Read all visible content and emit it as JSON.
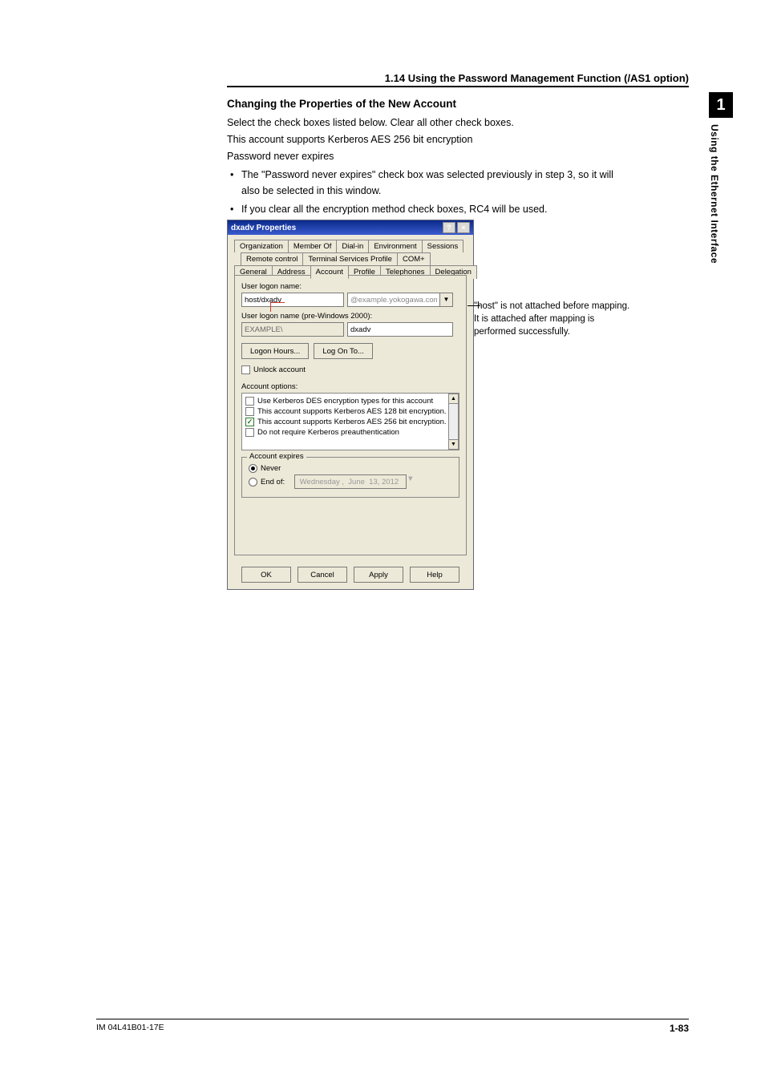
{
  "section": {
    "header": "1.14  Using the Password Management Function (/AS1 option)"
  },
  "chapter": {
    "number": "1",
    "side": "Using the Ethernet Interface"
  },
  "body": {
    "heading": "Changing the Properties of the New Account",
    "p1": "Select the check boxes listed below. Clear all other check boxes.",
    "p2": "This account supports Kerberos AES 256 bit encryption",
    "p3": "Password never expires",
    "li1": "The \"Password never expires\" check box was selected previously in step 3, so it will",
    "li1b": "also be selected in this window.",
    "li2": "If you clear all the encryption method check boxes, RC4 will be used."
  },
  "dialog": {
    "title": "dxadv Properties",
    "tabs_row1": [
      "Organization",
      "Member Of",
      "Dial-in",
      "Environment",
      "Sessions"
    ],
    "tabs_row2": [
      "Remote control",
      "Terminal Services Profile",
      "COM+"
    ],
    "tabs_row3": [
      "General",
      "Address",
      "Account",
      "Profile",
      "Telephones",
      "Delegation"
    ],
    "logon_label": "User logon name:",
    "logon_value": "host/dxadv",
    "domain_value": "@example.yokogawa.com",
    "pre2000_label": "User logon name (pre-Windows 2000):",
    "pre2000_domain": "EXAMPLE\\",
    "pre2000_user": "dxadv",
    "logon_hours_btn": "Logon Hours...",
    "log_on_to_btn": "Log On To...",
    "unlock_label": "Unlock account",
    "account_options_label": "Account options:",
    "opts": [
      {
        "text": "Use Kerberos DES encryption types for this account",
        "checked": false
      },
      {
        "text": "This account supports Kerberos AES 128 bit encryption.",
        "checked": false
      },
      {
        "text": "This account supports Kerberos AES 256 bit encryption.",
        "checked": true
      },
      {
        "text": "Do not require Kerberos preauthentication",
        "checked": false
      }
    ],
    "expires_group": "Account expires",
    "never_label": "Never",
    "end_of_label": "End of:",
    "end_of_value": " Wednesday ,  June  13, 2012",
    "ok": "OK",
    "cancel": "Cancel",
    "apply": "Apply",
    "help": "Help",
    "help_btn": "?",
    "close_btn": "×"
  },
  "callout": {
    "l1": "\"host\" is not attached before mapping.",
    "l2": "It is attached after mapping is",
    "l3": "performed successfully."
  },
  "footer": {
    "left": "IM 04L41B01-17E",
    "right": "1-83"
  }
}
